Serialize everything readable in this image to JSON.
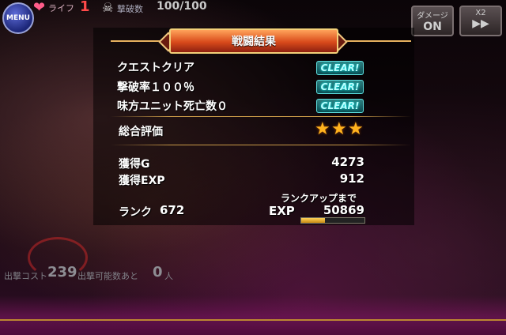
{
  "hud": {
    "menu_label": "MENU",
    "life_label": "ライフ",
    "life_value": "1",
    "kills_label": "撃破数",
    "kills_value": "100/100",
    "damage_button": {
      "line1": "ダメージ",
      "line2": "ON"
    },
    "speed_button": {
      "line1": "X2",
      "line2": "▶▶"
    }
  },
  "result": {
    "title": "戦闘結果",
    "conditions": [
      {
        "label": "クエストクリア",
        "badge": "CLEAR!"
      },
      {
        "label": "撃破率１００％",
        "badge": "CLEAR!"
      },
      {
        "label": "味方ユニット死亡数０",
        "badge": "CLEAR!"
      }
    ],
    "overall_label": "総合評価",
    "stars": [
      "★",
      "★",
      "★"
    ],
    "gold_label": "獲得G",
    "gold_value": "4273",
    "exp_label": "獲得EXP",
    "exp_value": "912",
    "rank_label": "ランク",
    "rank_value": "672",
    "rankup_label": "ランクアップまで",
    "exp_to_next_label": "EXP",
    "exp_to_next_value": "50869",
    "exp_progress_fraction": 0.38
  },
  "footer": {
    "cost_label": "出撃コスト",
    "cost_value": "239",
    "deploy_label": "出撃可能数あと",
    "deploy_value": "0",
    "deploy_unit": "人"
  },
  "colors": {
    "accent_gold": "#c7952f",
    "clear_cyan": "#5fe0e0",
    "star": "#ffb21e",
    "life_red": "#ff4a4a"
  }
}
